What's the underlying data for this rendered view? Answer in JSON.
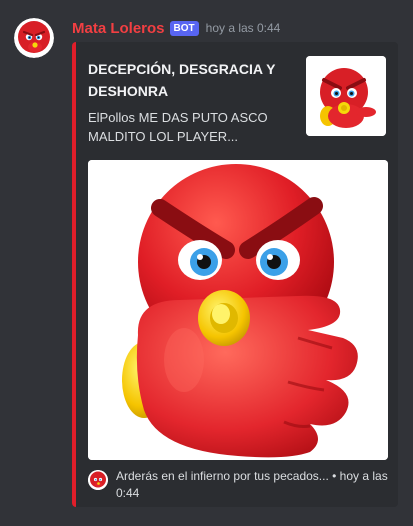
{
  "message": {
    "username": "Mata Loleros",
    "bot_tag": "BOT",
    "timestamp": "hoy a las 0:44",
    "avatar_icon": "angry-red-emoji-icon",
    "username_color": "#f23f42"
  },
  "embed": {
    "accent_color": "#e01e2a",
    "title": "DECEPCIÓN, DESGRACIA Y DESHONRA",
    "description": "ElPollos ME DAS PUTO ASCO MALDITO LOL PLAYER...",
    "thumbnail_icon": "angry-red-emoji-pointing-icon",
    "image_icon": "angry-red-emoji-pointing-icon",
    "footer": {
      "icon": "angry-red-emoji-icon",
      "text": "Arderás en el infierno por tus pecados... • hoy a las 0:44"
    }
  }
}
